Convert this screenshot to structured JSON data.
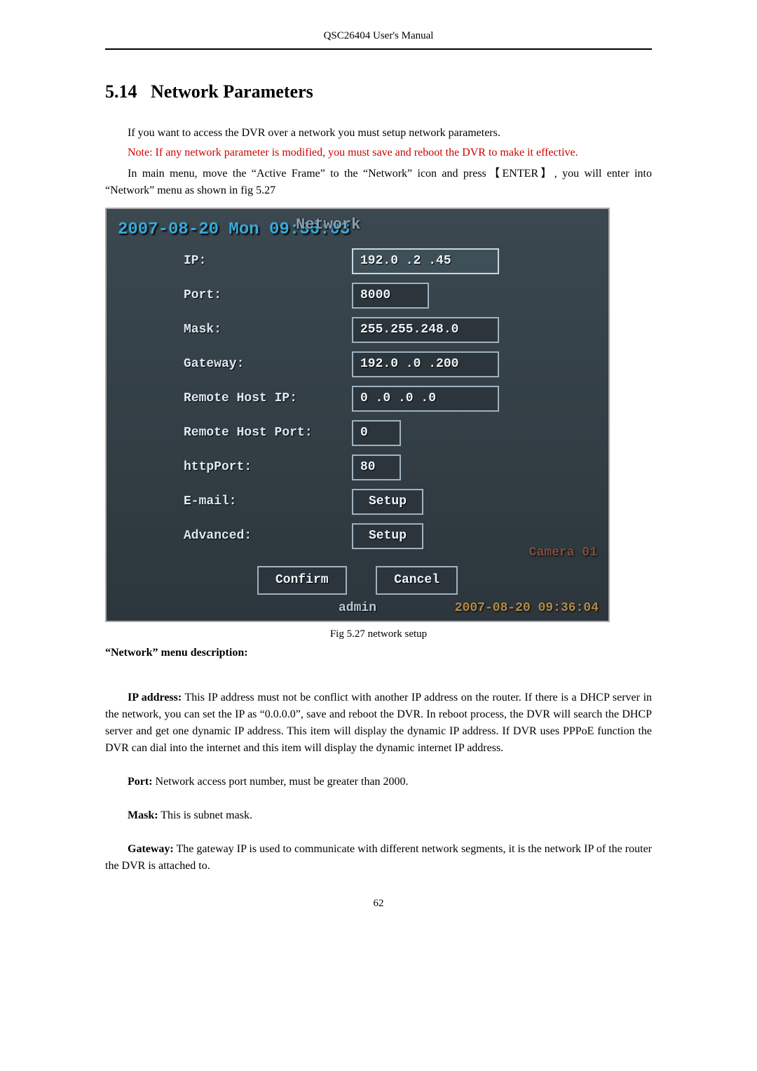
{
  "header": {
    "title": "QSC26404 User's Manual"
  },
  "section": {
    "number": "5.14",
    "title": "Network Parameters"
  },
  "paras": {
    "intro1": "If you want to access the DVR over a network you must setup network parameters.",
    "note_red": "Note: If any network parameter is modified, you must save and reboot the DVR to make it effective.",
    "intro2": "In main menu, move the “Active Frame” to the “Network” icon and press【ENTER】, you will enter into “Network” menu as shown in fig 5.27"
  },
  "screenshot": {
    "osd_date": "2007-08-20 Mon 09:36:03",
    "panel_title": "Network",
    "labels": {
      "ip": "IP:",
      "port": "Port:",
      "mask": "Mask:",
      "gateway": "Gateway:",
      "remote_ip": "Remote Host IP:",
      "remote_port": "Remote Host Port:",
      "http_port": "httpPort:",
      "email": "E-mail:",
      "advanced": "Advanced:"
    },
    "values": {
      "ip": "192.0  .2  .45",
      "port": "8000",
      "mask": "255.255.248.0",
      "gateway": "192.0  .0  .200",
      "remote_ip": "0   .0   .0   .0",
      "remote_port": "0",
      "http_port": "80",
      "setup": "Setup"
    },
    "buttons": {
      "confirm": "Confirm",
      "cancel": "Cancel"
    },
    "status": {
      "user": "admin",
      "timestamp": "2007-08-20 09:36:04",
      "camera": "Camera 01"
    }
  },
  "figcap": "Fig 5.27 network setup",
  "desc_title": "“Network” menu description:",
  "desc": {
    "ip_label": "IP address:",
    "ip_text": " This IP address must not be conflict with another IP address on the router. If there is a DHCP server in the network, you can set the IP as “0.0.0.0”, save and reboot the DVR. In reboot process, the DVR will search the DHCP server and get one dynamic IP address. This item will display the dynamic IP address. If DVR uses PPPoE function the DVR can dial into the internet and this item will display the dynamic internet IP address.",
    "port_label": "Port:",
    "port_text": " Network access port number, must be greater than 2000.",
    "mask_label": "Mask:",
    "mask_text": " This is subnet mask.",
    "gateway_label": "Gateway:",
    "gateway_text": " The gateway IP is used to communicate with different network segments, it is the network IP of the router the DVR is attached to."
  },
  "page_number": "62"
}
